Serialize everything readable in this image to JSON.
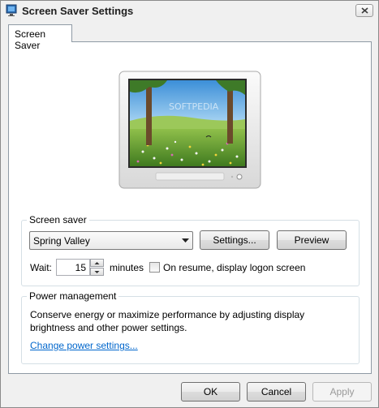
{
  "window": {
    "title": "Screen Saver Settings"
  },
  "tabs": [
    {
      "label": "Screen Saver"
    }
  ],
  "preview_watermark": "SOFTPEDIA",
  "screen_saver": {
    "group_label": "Screen saver",
    "selected": "Spring Valley",
    "settings_button": "Settings...",
    "preview_button": "Preview",
    "wait_label": "Wait:",
    "wait_value": "15",
    "minutes_label": "minutes",
    "on_resume_label": "On resume, display logon screen",
    "on_resume_checked": false
  },
  "power": {
    "group_label": "Power management",
    "description": "Conserve energy or maximize performance by adjusting display brightness and other power settings.",
    "link": "Change power settings..."
  },
  "footer": {
    "ok": "OK",
    "cancel": "Cancel",
    "apply": "Apply"
  }
}
